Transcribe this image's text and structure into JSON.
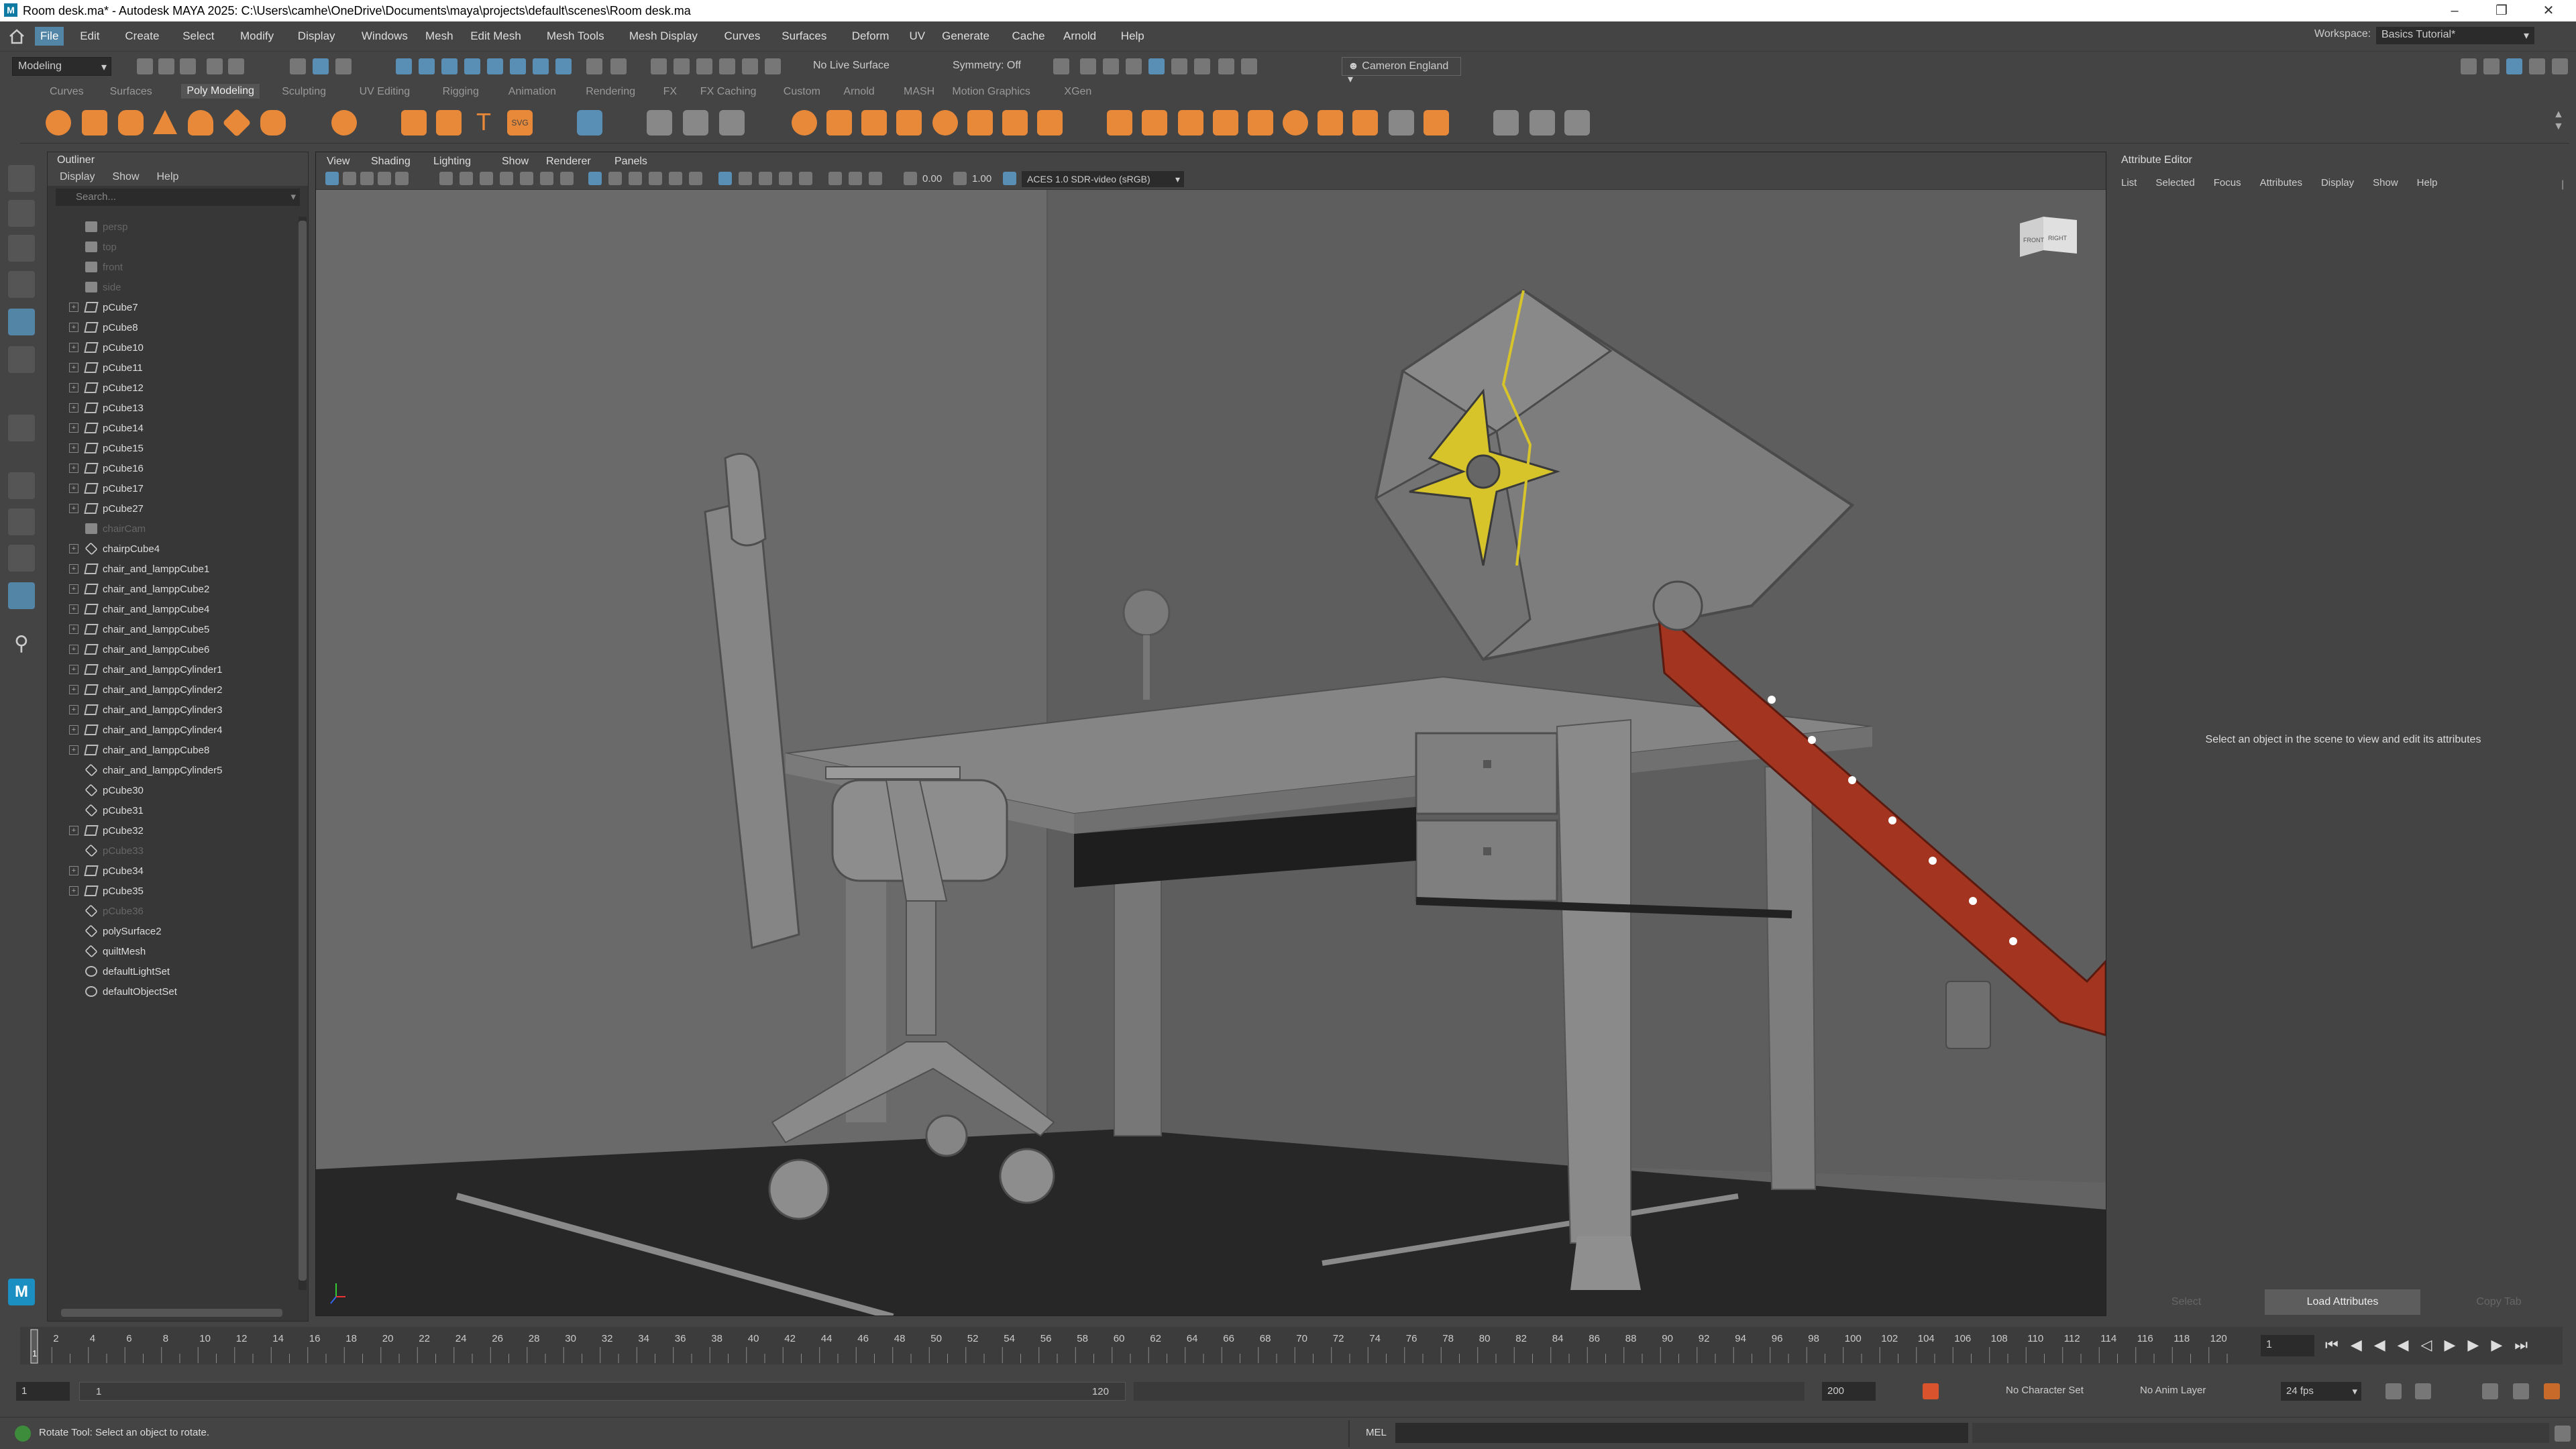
{
  "window": {
    "title": "Room desk.ma* - Autodesk MAYA 2025: C:\\Users\\camhe\\OneDrive\\Documents\\maya\\projects\\default\\scenes\\Room desk.ma",
    "logo_letter": "M"
  },
  "menubar": {
    "items": [
      "File",
      "Edit",
      "Create",
      "Select",
      "Modify",
      "Display",
      "Windows",
      "Mesh",
      "Edit Mesh",
      "Mesh Tools",
      "Mesh Display",
      "Curves",
      "Surfaces",
      "Deform",
      "UV",
      "Generate",
      "Cache",
      "Arnold",
      "Help"
    ],
    "workspace_label": "Workspace:",
    "workspace_value": "Basics Tutorial*"
  },
  "statusline": {
    "mode": "Modeling",
    "live_surface": "No Live Surface",
    "symmetry": "Symmetry: Off",
    "user": "Cameron England"
  },
  "shelf": {
    "tabs": [
      "Curves",
      "Surfaces",
      "Poly Modeling",
      "Sculpting",
      "UV Editing",
      "Rigging",
      "Animation",
      "Rendering",
      "FX",
      "FX Caching",
      "Custom",
      "Arnold",
      "MASH",
      "Motion Graphics",
      "XGen"
    ],
    "active_tab": "Poly Modeling",
    "accent_color": "#e8893a"
  },
  "outliner": {
    "title": "Outliner",
    "menu": [
      "Display",
      "Show",
      "Help"
    ],
    "search_placeholder": "Search...",
    "items": [
      {
        "label": "persp",
        "icon": "camera-icon",
        "dim": true,
        "expand": false
      },
      {
        "label": "top",
        "icon": "camera-icon",
        "dim": true,
        "expand": false
      },
      {
        "label": "front",
        "icon": "camera-icon",
        "dim": true,
        "expand": false
      },
      {
        "label": "side",
        "icon": "camera-icon",
        "dim": true,
        "expand": false
      },
      {
        "label": "pCube7",
        "icon": "mesh-icon",
        "dim": false,
        "expand": true
      },
      {
        "label": "pCube8",
        "icon": "mesh-icon",
        "dim": false,
        "expand": true
      },
      {
        "label": "pCube10",
        "icon": "mesh-icon",
        "dim": false,
        "expand": true
      },
      {
        "label": "pCube11",
        "icon": "mesh-icon",
        "dim": false,
        "expand": true
      },
      {
        "label": "pCube12",
        "icon": "mesh-icon",
        "dim": false,
        "expand": true
      },
      {
        "label": "pCube13",
        "icon": "mesh-icon",
        "dim": false,
        "expand": true
      },
      {
        "label": "pCube14",
        "icon": "mesh-icon",
        "dim": false,
        "expand": true
      },
      {
        "label": "pCube15",
        "icon": "mesh-icon",
        "dim": false,
        "expand": true
      },
      {
        "label": "pCube16",
        "icon": "mesh-icon",
        "dim": false,
        "expand": true
      },
      {
        "label": "pCube17",
        "icon": "mesh-icon",
        "dim": false,
        "expand": true
      },
      {
        "label": "pCube27",
        "icon": "mesh-icon",
        "dim": false,
        "expand": true
      },
      {
        "label": "chairCam",
        "icon": "camera-icon",
        "dim": true,
        "expand": false
      },
      {
        "label": "chairpCube4",
        "icon": "group-icon",
        "dim": false,
        "expand": true
      },
      {
        "label": "chair_and_lamppCube1",
        "icon": "mesh-icon",
        "dim": false,
        "expand": true
      },
      {
        "label": "chair_and_lamppCube2",
        "icon": "mesh-icon",
        "dim": false,
        "expand": true
      },
      {
        "label": "chair_and_lamppCube4",
        "icon": "mesh-icon",
        "dim": false,
        "expand": true
      },
      {
        "label": "chair_and_lamppCube5",
        "icon": "mesh-icon",
        "dim": false,
        "expand": true
      },
      {
        "label": "chair_and_lamppCube6",
        "icon": "mesh-icon",
        "dim": false,
        "expand": true
      },
      {
        "label": "chair_and_lamppCylinder1",
        "icon": "mesh-icon",
        "dim": false,
        "expand": true
      },
      {
        "label": "chair_and_lamppCylinder2",
        "icon": "mesh-icon",
        "dim": false,
        "expand": true
      },
      {
        "label": "chair_and_lamppCylinder3",
        "icon": "mesh-icon",
        "dim": false,
        "expand": true
      },
      {
        "label": "chair_and_lamppCylinder4",
        "icon": "mesh-icon",
        "dim": false,
        "expand": true
      },
      {
        "label": "chair_and_lamppCube8",
        "icon": "mesh-icon",
        "dim": false,
        "expand": true
      },
      {
        "label": "chair_and_lamppCylinder5",
        "icon": "group-icon",
        "dim": false,
        "expand": false
      },
      {
        "label": "pCube30",
        "icon": "group-icon",
        "dim": false,
        "expand": false
      },
      {
        "label": "pCube31",
        "icon": "group-icon",
        "dim": false,
        "expand": false
      },
      {
        "label": "pCube32",
        "icon": "mesh-icon",
        "dim": false,
        "expand": true
      },
      {
        "label": "pCube33",
        "icon": "group-icon",
        "dim": true,
        "expand": false
      },
      {
        "label": "pCube34",
        "icon": "mesh-icon",
        "dim": false,
        "expand": true
      },
      {
        "label": "pCube35",
        "icon": "mesh-icon",
        "dim": false,
        "expand": true
      },
      {
        "label": "pCube36",
        "icon": "group-icon",
        "dim": true,
        "expand": false
      },
      {
        "label": "polySurface2",
        "icon": "group-icon",
        "dim": false,
        "expand": false
      },
      {
        "label": "quiltMesh",
        "icon": "group-icon",
        "dim": false,
        "expand": false
      },
      {
        "label": "defaultLightSet",
        "icon": "set-icon",
        "dim": false,
        "expand": false
      },
      {
        "label": "defaultObjectSet",
        "icon": "set-icon",
        "dim": false,
        "expand": false
      }
    ]
  },
  "viewport": {
    "menu": [
      "View",
      "Shading",
      "Lighting",
      "Show",
      "Renderer",
      "Panels"
    ],
    "exposure": "0.00",
    "gamma": "1.00",
    "colorspace": "ACES 1.0 SDR-video (sRGB)",
    "viewcube_front": "FRONT",
    "viewcube_right": "RIGHT"
  },
  "attribute_editor": {
    "title": "Attribute Editor",
    "menu": [
      "List",
      "Selected",
      "Focus",
      "Attributes",
      "Display",
      "Show",
      "Help"
    ],
    "message": "Select an object in the scene to view and edit its attributes",
    "buttons": [
      "Select",
      "Load Attributes",
      "Copy Tab"
    ]
  },
  "timeline": {
    "ticks": [
      "2",
      "4",
      "6",
      "8",
      "10",
      "12",
      "14",
      "16",
      "18",
      "20",
      "22",
      "24",
      "26",
      "28",
      "30",
      "32",
      "34",
      "36",
      "38",
      "40",
      "42",
      "44",
      "46",
      "48",
      "50",
      "52",
      "54",
      "56",
      "58",
      "60",
      "62",
      "64",
      "66",
      "68",
      "70",
      "72",
      "74",
      "76",
      "78",
      "80",
      "82",
      "84",
      "86",
      "88",
      "90",
      "92",
      "94",
      "96",
      "98",
      "100",
      "102",
      "104",
      "106",
      "108",
      "110",
      "112",
      "114",
      "116",
      "118",
      "120"
    ],
    "current_frame": "1",
    "playhead_label": "1"
  },
  "range": {
    "start": "1",
    "inner_start": "1",
    "inner_end": "120",
    "end": "200",
    "character_set": "No Character Set",
    "anim_layer": "No Anim Layer",
    "fps": "24 fps"
  },
  "command": {
    "help_text": "Rotate Tool: Select an object to rotate.",
    "lang": "MEL"
  }
}
